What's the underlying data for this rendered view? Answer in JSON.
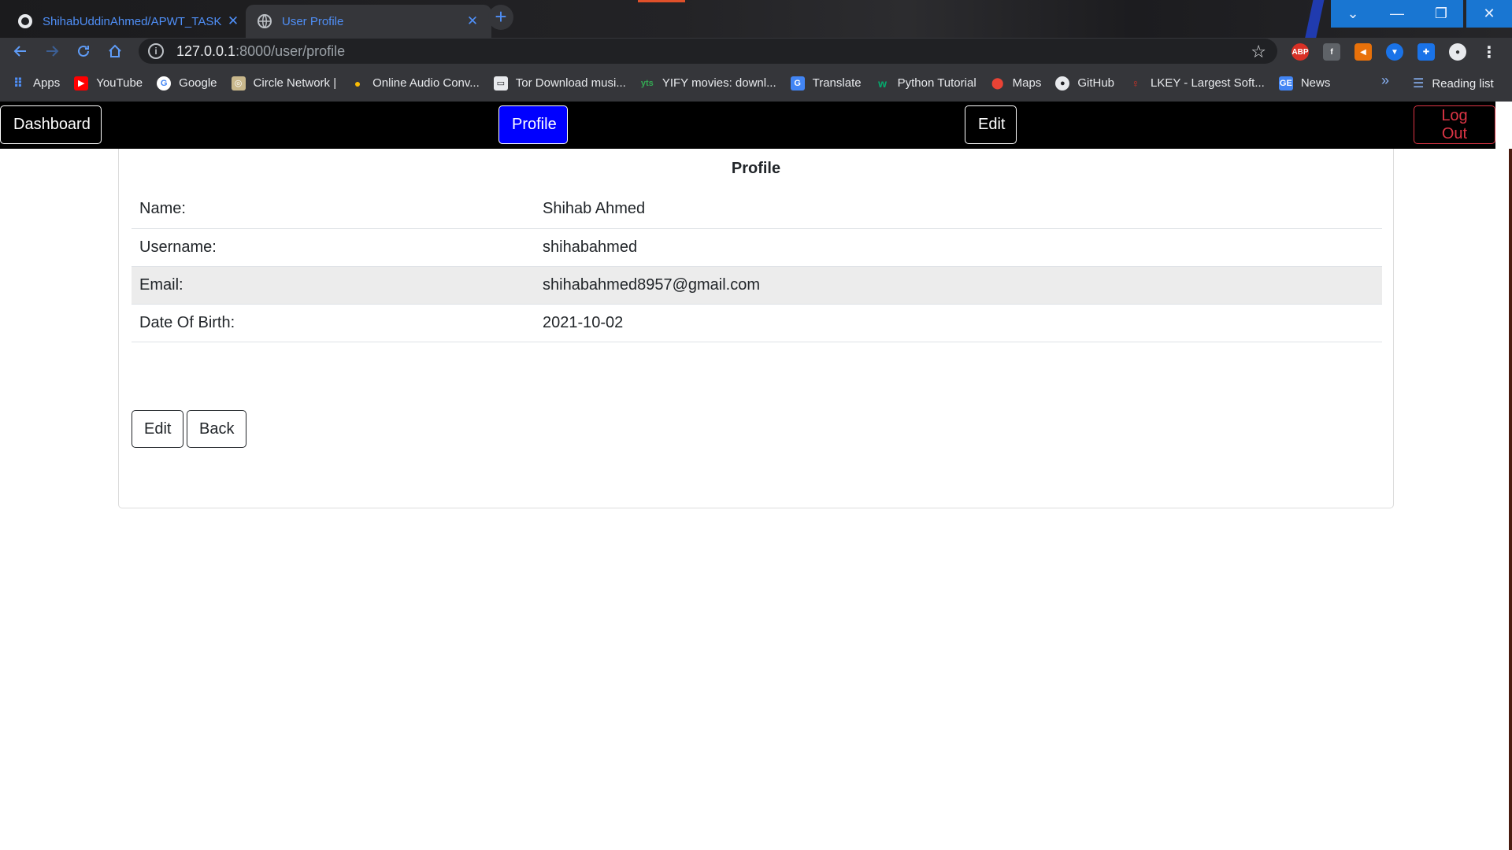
{
  "browser": {
    "tabs": [
      {
        "title": "ShihabUddinAhmed/APWT_TASK",
        "active": false
      },
      {
        "title": "User Profile",
        "active": true
      }
    ],
    "url_host": "127.0.0.1",
    "url_path": ":8000/user/profile",
    "bookmarks": [
      {
        "label": "Apps",
        "icon": "apps-grid-icon"
      },
      {
        "label": "YouTube",
        "icon": "youtube-icon"
      },
      {
        "label": "Google",
        "icon": "google-icon"
      },
      {
        "label": "Circle Network |",
        "icon": "circle-network-icon"
      },
      {
        "label": "Online Audio Conv...",
        "icon": "audio-converter-icon"
      },
      {
        "label": "Tor Download musi...",
        "icon": "tor-download-icon"
      },
      {
        "label": "YIFY movies: downl...",
        "icon": "yify-icon"
      },
      {
        "label": "Translate",
        "icon": "translate-icon"
      },
      {
        "label": "Python Tutorial",
        "icon": "w3schools-icon"
      },
      {
        "label": "Maps",
        "icon": "maps-pin-icon"
      },
      {
        "label": "GitHub",
        "icon": "github-icon"
      },
      {
        "label": "LKEY - Largest Soft...",
        "icon": "lkey-icon"
      },
      {
        "label": "News",
        "icon": "news-icon"
      }
    ],
    "reading_list": "Reading list",
    "more_bookmarks": "»"
  },
  "navbar": {
    "dashboard": "Dashboard",
    "profile": "Profile",
    "edit": "Edit",
    "logout": "Log Out"
  },
  "profile": {
    "title": "Profile",
    "rows": [
      {
        "label": "Name:",
        "value": "Shihab Ahmed"
      },
      {
        "label": "Username:",
        "value": "shihabahmed"
      },
      {
        "label": "Email:",
        "value": "shihabahmed8957@gmail.com"
      },
      {
        "label": "Date Of Birth:",
        "value": "2021-10-02"
      }
    ],
    "edit_button": "Edit",
    "back_button": "Back"
  }
}
